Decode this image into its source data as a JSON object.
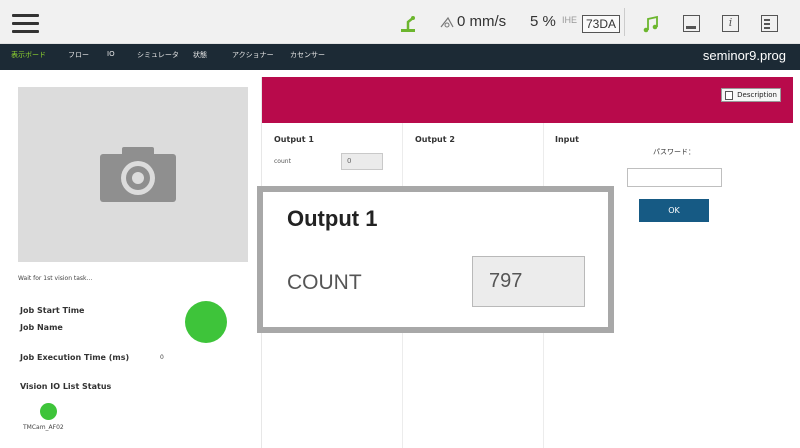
{
  "status": {
    "speed": "0 mm/s",
    "percent": "5 %",
    "small_badge": "IHE",
    "mode_box": "73DA"
  },
  "nav": {
    "items": [
      "表示ボード",
      "フロー",
      "IO",
      "シミュレータ",
      "状態",
      "アクショナー",
      "カセンサー"
    ],
    "active_index": 0,
    "filename": "seminor9.prog"
  },
  "left": {
    "wait_text": "Wait for 1st vision task...",
    "job_start_time": "Job Start Time",
    "job_name": "Job Name",
    "job_exec_time": "Job Execution Time (ms)",
    "job_exec_value": "0",
    "vision_io_status": "Vision IO List Status",
    "camera_label": "TMCam_AF02",
    "status_color": "#3ec43a"
  },
  "right": {
    "description_label": "Description",
    "output1_title": "Output 1",
    "output2_title": "Output 2",
    "input_title": "Input",
    "count_label": "count",
    "count_value": "0",
    "password_label": "パスワード：",
    "ok_label": "OK",
    "header_color": "#b80a4b"
  },
  "zoom": {
    "title": "Output 1",
    "count_label": "COUNT",
    "count_value": "797"
  }
}
